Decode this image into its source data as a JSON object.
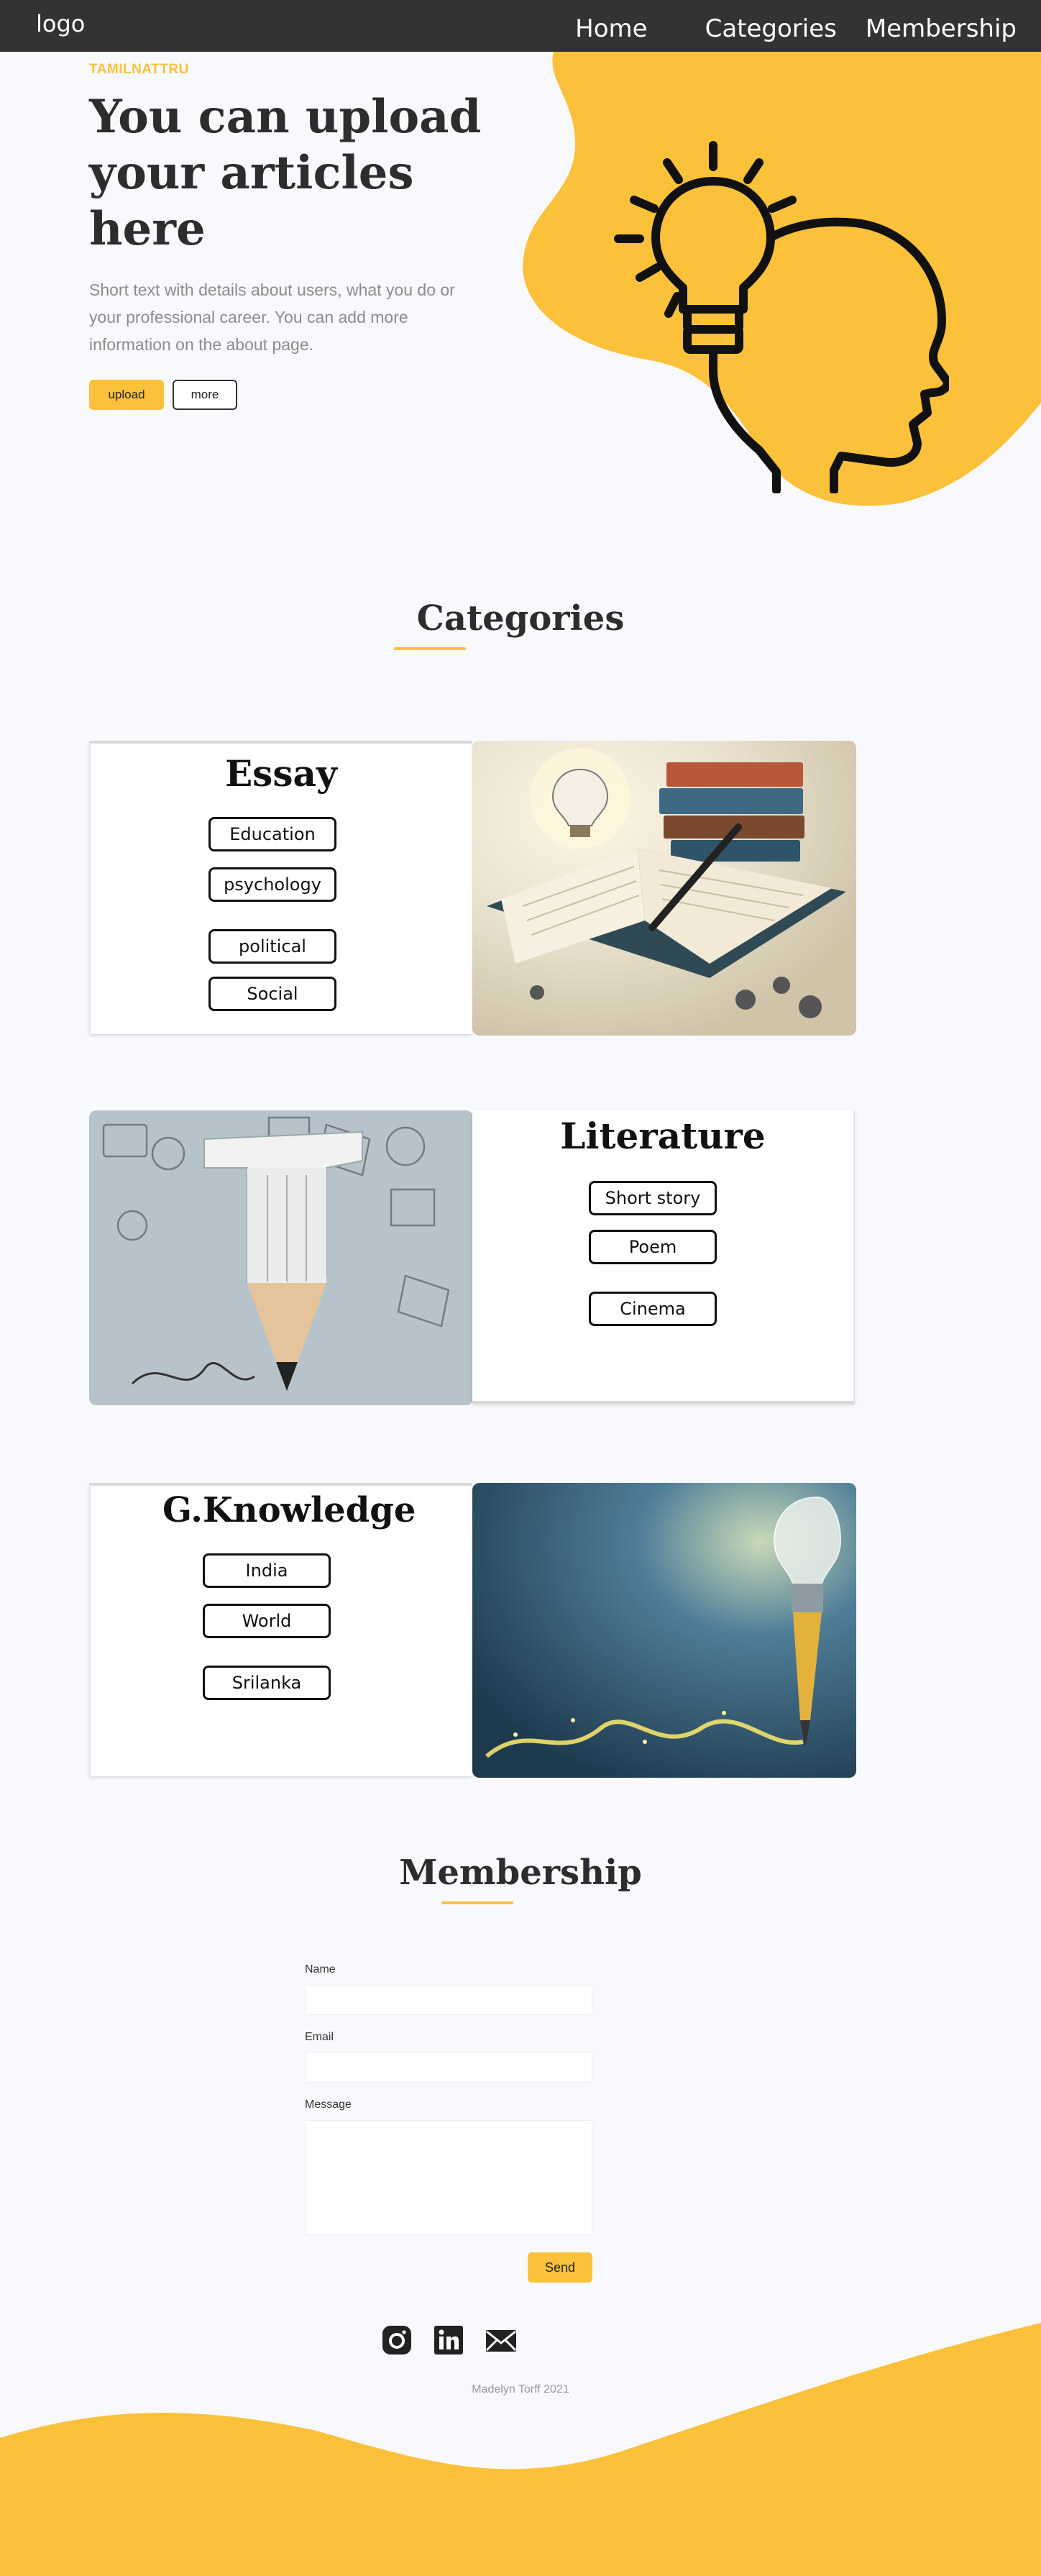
{
  "nav": {
    "logo": "logo",
    "links": [
      "Home",
      "Categories",
      "Membership"
    ]
  },
  "hero": {
    "kicker": "TAMILNATTRU",
    "title": "You can upload your articles here",
    "text": "Short text with details about users, what you do or your professional career. You can add more information on the about page.",
    "upload_label": "upload",
    "more_label": "more"
  },
  "categories": {
    "heading": "Categories",
    "essay": {
      "title": "Essay",
      "tags": [
        "Education",
        "psychology",
        "political",
        "Social"
      ]
    },
    "literature": {
      "title": "Literature",
      "tags": [
        "Short story",
        "Poem",
        "Cinema"
      ]
    },
    "gk": {
      "title": "G.Knowledge",
      "tags": [
        "India",
        "World",
        "Srilanka"
      ]
    }
  },
  "membership": {
    "heading": "Membership",
    "name_label": "Name",
    "email_label": "Email",
    "message_label": "Message",
    "send_label": "Send"
  },
  "footer": {
    "social_icons": [
      "instagram-icon",
      "linkedin-icon",
      "mail-icon"
    ],
    "copyright": "Madelyn Torff 2021"
  },
  "colors": {
    "accent": "#fbc13a",
    "nav_bg": "#333333",
    "page_bg": "#f8f9fd",
    "text_dark": "#2d2d2d",
    "text_muted": "#8c8c8c"
  }
}
